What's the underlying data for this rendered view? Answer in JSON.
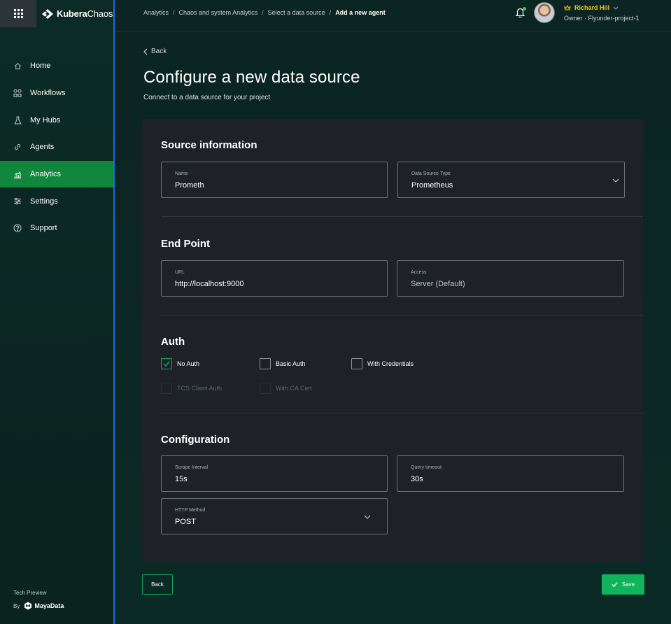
{
  "brand": {
    "name_bold": "Kubera",
    "name_light": "Chaos"
  },
  "sidebar": {
    "items": [
      {
        "label": "Home",
        "icon": "home-icon"
      },
      {
        "label": "Workflows",
        "icon": "workflows-icon"
      },
      {
        "label": "My Hubs",
        "icon": "flask-icon"
      },
      {
        "label": "Agents",
        "icon": "link-icon"
      },
      {
        "label": "Analytics",
        "icon": "analytics-icon",
        "active": true
      },
      {
        "label": "Settings",
        "icon": "sliders-icon"
      },
      {
        "label": "Support",
        "icon": "help-icon"
      }
    ],
    "footer": {
      "tech_preview": "Tech Preview",
      "by": "By",
      "company": "MayaData"
    }
  },
  "header": {
    "breadcrumb": [
      "Analytics",
      "Chaos and system Analytics",
      "Select a data source",
      "Add a new agent"
    ],
    "separator": "/",
    "user": {
      "name": "Richard Hill",
      "role": "Owner · Flyunder-project-1"
    }
  },
  "page": {
    "back_label": "Back",
    "title": "Configure a new data source",
    "subtitle": "Connect to a data source for your project"
  },
  "form": {
    "source_info": {
      "title": "Source information",
      "name": {
        "label": "Name",
        "value": "Prometh"
      },
      "type": {
        "label": "Data Source Type",
        "value": "Prometheus"
      }
    },
    "endpoint": {
      "title": "End Point",
      "url": {
        "label": "URL",
        "value": "http://localhost:9000"
      },
      "access": {
        "label": "Access",
        "value": "Server (Default)"
      }
    },
    "auth": {
      "title": "Auth",
      "options": [
        {
          "label": "No Auth",
          "checked": true,
          "disabled": false
        },
        {
          "label": "Basic Auth",
          "checked": false,
          "disabled": false
        },
        {
          "label": "With Credentials",
          "checked": false,
          "disabled": false
        },
        {
          "label": "TCS Client Auth",
          "checked": false,
          "disabled": true
        },
        {
          "label": "With CA Cert",
          "checked": false,
          "disabled": true
        }
      ]
    },
    "configuration": {
      "title": "Configuration",
      "scrape": {
        "label": "Scrape Interval",
        "value": "15s"
      },
      "timeout": {
        "label": "Query timeout",
        "value": "30s"
      },
      "http_method": {
        "label": "HTTP Method",
        "value": "POST"
      }
    }
  },
  "actions": {
    "back_label": "Back",
    "save_label": "Save"
  },
  "colors": {
    "accent": "#10b45a",
    "active_nav": "#10873d",
    "user_name": "#f5c518",
    "card_bg": "#1e2227",
    "page_bg": "#0b2622"
  }
}
